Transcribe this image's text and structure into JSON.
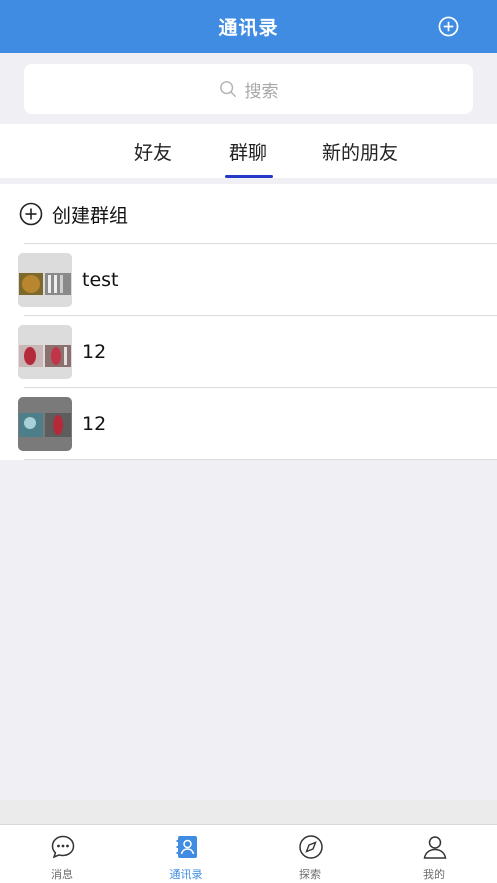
{
  "header": {
    "title": "通讯录",
    "add_icon": "plus-circle-icon"
  },
  "search": {
    "placeholder": "搜索",
    "icon": "search-icon"
  },
  "tabs": [
    {
      "label": "好友",
      "active": false
    },
    {
      "label": "群聊",
      "active": true
    },
    {
      "label": "新的朋友",
      "active": false
    }
  ],
  "create_group": {
    "label": "创建群组",
    "icon": "plus-circle-icon"
  },
  "groups": [
    {
      "name": "test",
      "avatar": "group-avatar"
    },
    {
      "name": "12",
      "avatar": "group-avatar"
    },
    {
      "name": "12",
      "avatar": "group-avatar"
    }
  ],
  "tabbar": [
    {
      "label": "消息",
      "icon": "chat-bubble-icon",
      "active": false
    },
    {
      "label": "通讯录",
      "icon": "contacts-book-icon",
      "active": true
    },
    {
      "label": "探索",
      "icon": "compass-icon",
      "active": false
    },
    {
      "label": "我的",
      "icon": "person-icon",
      "active": false
    }
  ],
  "colors": {
    "primary": "#3f8ce2",
    "tab_indicator": "#2638c8",
    "background": "#efeff4"
  }
}
